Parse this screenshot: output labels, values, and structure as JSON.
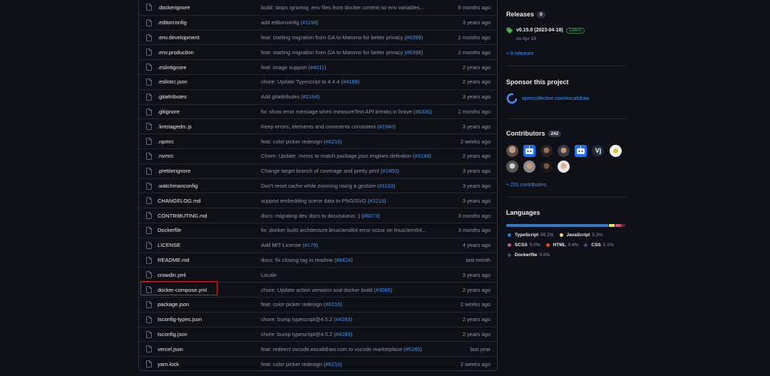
{
  "files": [
    {
      "name": ".dockerignore",
      "message": "build: stops ignoring .env files from docker context so env variables...",
      "pr": "",
      "age": "6 months ago"
    },
    {
      "name": ".editorconfig",
      "message": "add editorconfig (",
      "pr": "#1198",
      "age": "3 years ago"
    },
    {
      "name": ".env.development",
      "message": "feat: starting migration from GA to Matomo for better privacy (",
      "pr": "#6398",
      "age": "2 months ago"
    },
    {
      "name": ".env.production",
      "message": "feat: starting migration from GA to Matomo for better privacy (",
      "pr": "#6398",
      "age": "2 months ago"
    },
    {
      "name": ".eslintignore",
      "message": "feat: image support (",
      "pr": "#4011",
      "age": "2 years ago"
    },
    {
      "name": ".eslintrc.json",
      "message": "chore: Update Typescript to 4.4.4 (",
      "pr": "#4188",
      "age": "2 years ago"
    },
    {
      "name": ".gitattributes",
      "message": "Add gitattributes (",
      "pr": "#2164",
      "age": "3 years ago"
    },
    {
      "name": ".gitignore",
      "message": "fix: show error message when measureText API breaks in brave (",
      "pr": "#6336",
      "age": "2 months ago"
    },
    {
      "name": ".lintstagedrc.js",
      "message": "Keep errors, elements and comments consistent (",
      "pr": "#2340",
      "age": "3 years ago"
    },
    {
      "name": ".npmrc",
      "message": "feat: color picker redesign (",
      "pr": "#6216",
      "age": "2 weeks ago"
    },
    {
      "name": ".nvmrc",
      "message": "Chore: Update .nvmrc to match package.json engines definition (",
      "pr": "#3148",
      "age": "2 years ago"
    },
    {
      "name": ".prettierignore",
      "message": "Change target branch of coverage and pretty print (",
      "pr": "#1850",
      "age": "3 years ago"
    },
    {
      "name": ".watchmanconfig",
      "message": "Don't reset cache while zooming using a gesture (",
      "pr": "#1103",
      "age": "3 years ago"
    },
    {
      "name": "CHANGELOG.md",
      "message": "support embedding scene data to PNG/SVG (",
      "pr": "#2219",
      "age": "3 years ago"
    },
    {
      "name": "CONTRIBUTING.md",
      "message": "docs: migrating dev docs to docusaurus :) (",
      "pr": "#6073",
      "age": "3 months ago"
    },
    {
      "name": "Dockerfile",
      "message": "fix: docker build architecture:linux/amd64 error occur on linux/arm64...",
      "pr": "",
      "age": "3 months ago"
    },
    {
      "name": "LICENSE",
      "message": "Add MIT License (",
      "pr": "#176",
      "age": "4 years ago"
    },
    {
      "name": "README.md",
      "message": "docs: fix closing tag in readme (",
      "pr": "#6424",
      "age": "last month"
    },
    {
      "name": "crowdin.yml",
      "message": "Locale",
      "pr": "",
      "age": "3 years ago"
    },
    {
      "name": "docker-compose.yml",
      "message": "chore: Update action versions and docker build (",
      "pr": "#3065",
      "age": "2 years ago"
    },
    {
      "name": "package.json",
      "message": "feat: color picker redesign (",
      "pr": "#6216",
      "age": "2 weeks ago"
    },
    {
      "name": "tsconfig-types.json",
      "message": "chore: bump typescript@4.5.2 (",
      "pr": "#4283",
      "age": "2 years ago"
    },
    {
      "name": "tsconfig.json",
      "message": "chore: bump typescript@4.5.2 (",
      "pr": "#4283",
      "age": "2 years ago"
    },
    {
      "name": "vercel.json",
      "message": "feat: redirect vscode.excalidraw.com to vscode marketplace (",
      "pr": "#5285",
      "age": "last year"
    },
    {
      "name": "yarn.lock",
      "message": "feat: color picker redesign (",
      "pr": "#6216",
      "age": "2 weeks ago"
    }
  ],
  "releases": {
    "title": "Releases",
    "count": "9",
    "tag": "v0.15.0 (2023-04-18)",
    "badge": "Latest",
    "date": "on Apr 18",
    "more": "+ 8 releases"
  },
  "sponsor": {
    "title": "Sponsor this project",
    "link": "opencollective.com/excalidraw"
  },
  "contributors": {
    "title": "Contributors",
    "count": "242",
    "more": "+ 231 contributors",
    "vj_label": "Vj"
  },
  "languages": {
    "title": "Languages",
    "items": [
      {
        "name": "TypeScript",
        "pct": "89.2%",
        "value": 89.2,
        "color": "#3178c6"
      },
      {
        "name": "JavaScript",
        "pct": "5.3%",
        "value": 5.3,
        "color": "#f1e05a"
      },
      {
        "name": "SCSS",
        "pct": "5.0%",
        "value": 5.0,
        "color": "#c6538c"
      },
      {
        "name": "HTML",
        "pct": "0.4%",
        "value": 0.4,
        "color": "#e34c26"
      },
      {
        "name": "CSS",
        "pct": "0.1%",
        "value": 0.1,
        "color": "#563d7c"
      },
      {
        "name": "Dockerfile",
        "pct": "0.0%",
        "value": 0.0,
        "color": "#384d54"
      }
    ]
  },
  "colors": {
    "accent": "#4493f8",
    "highlight": "#d1242f"
  }
}
